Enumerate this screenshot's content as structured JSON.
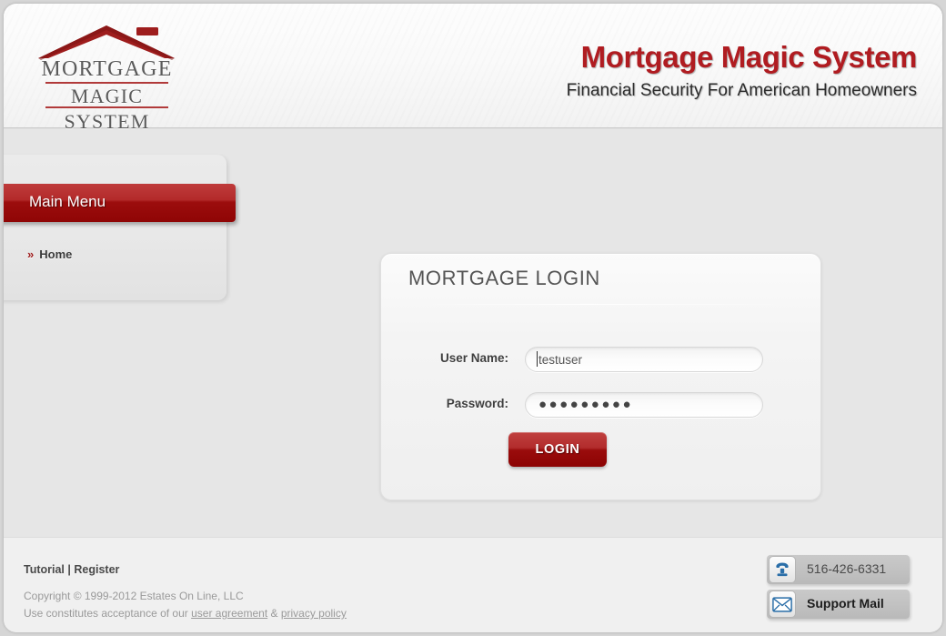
{
  "header": {
    "logo": {
      "line1": "MORTGAGE",
      "line2": "MAGIC",
      "line3": "SYSTEM",
      "icon": "house-roof-icon"
    },
    "brand_title": "Mortgage Magic System",
    "brand_subtitle": "Financial Security For American Homeowners"
  },
  "sidebar": {
    "menu_title": "Main Menu",
    "items": [
      {
        "label": "Home",
        "arrow": "»"
      }
    ]
  },
  "login": {
    "title": "MORTGAGE LOGIN",
    "username_label": "User Name:",
    "username_value": "testuser",
    "username_placeholder": "",
    "password_label": "Password:",
    "password_value": "●●●●●●●●●",
    "password_placeholder": "",
    "submit_label": "LOGIN"
  },
  "footer": {
    "tutorial_label": "Tutorial",
    "separator": "|",
    "register_label": "Register",
    "copyright": "Copyright © 1999-2012 Estates On Line, LLC",
    "terms_prefix": "Use constitutes acceptance of our ",
    "user_agreement_label": "user agreement",
    "terms_amp": " & ",
    "privacy_policy_label": "privacy policy",
    "phone": "516-426-6331",
    "phone_icon": "telephone-icon",
    "support_mail_label": "Support Mail",
    "mail_icon": "envelope-icon"
  },
  "colors": {
    "brand_red": "#b01c21",
    "menu_red": "#9c0d0d",
    "page_bg": "#e6e6e6",
    "footer_bg": "#f0f0f0"
  }
}
